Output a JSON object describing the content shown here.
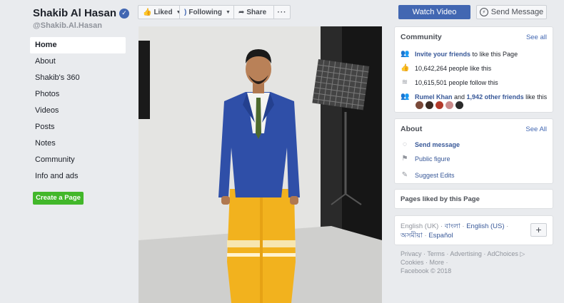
{
  "page": {
    "name": "Shakib Al Hasan",
    "handle": "@Shakib.Al.Hasan"
  },
  "sidebar": {
    "items": [
      {
        "label": "Home"
      },
      {
        "label": "About"
      },
      {
        "label": "Shakib's 360"
      },
      {
        "label": "Photos"
      },
      {
        "label": "Videos"
      },
      {
        "label": "Posts"
      },
      {
        "label": "Notes"
      },
      {
        "label": "Community"
      },
      {
        "label": "Info and ads"
      }
    ],
    "create_page": "Create a Page"
  },
  "actions": {
    "liked": "Liked",
    "following": "Following",
    "share": "Share",
    "more": "···",
    "watch_video": "Watch Video",
    "send_message": "Send Message"
  },
  "community": {
    "title": "Community",
    "see_all": "See all",
    "invite_link": "Invite your friends",
    "invite_rest": " to like this Page",
    "likes": "10,642,264 people like this",
    "follows": "10,615,501 people follow this",
    "friend_name": "Rumel Khan",
    "friend_and": " and ",
    "friend_others": "1,942 other friends",
    "friend_rest": " like this"
  },
  "about": {
    "title": "About",
    "see_all": "See All",
    "send_message": "Send message",
    "category": "Public figure",
    "suggest": "Suggest Edits"
  },
  "pages_liked": {
    "title": "Pages liked by this Page"
  },
  "languages": {
    "current": "English (UK)",
    "sep": " · ",
    "items": [
      "বাংলা",
      "English (US)",
      "অসমীয়া",
      "Español"
    ],
    "plus": "+"
  },
  "footer": {
    "line1": "Privacy · Terms · Advertising · AdChoices ▷",
    "line2": "Cookies · More ·",
    "line3": "Facebook © 2018"
  },
  "colors": {
    "brand": "#4267b2",
    "link": "#385898",
    "create_green": "#42b72a",
    "background": "#e9ebee"
  }
}
